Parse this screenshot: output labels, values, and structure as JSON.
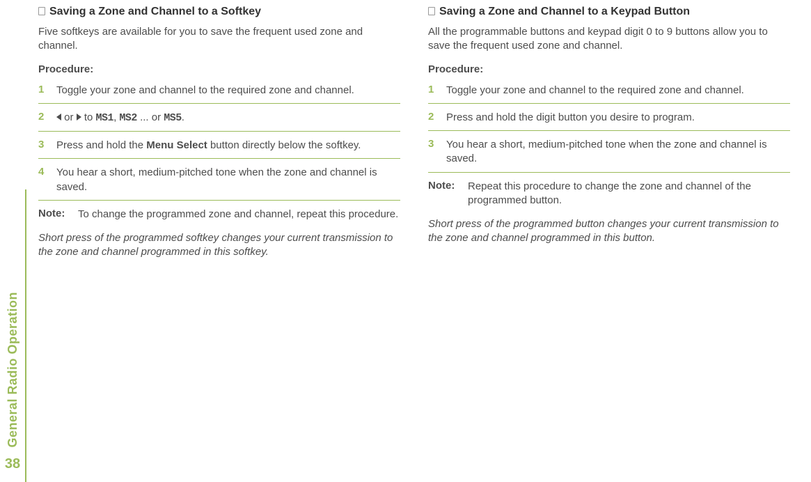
{
  "side": {
    "section_title": "General Radio Operation",
    "page_number": "38"
  },
  "left": {
    "heading": "Saving a Zone and Channel to a Softkey",
    "intro": "Five softkeys are available for you to save the frequent used zone and channel.",
    "procedure_label": "Procedure:",
    "steps": {
      "n1": "1",
      "s1": "Toggle your zone and channel to the required zone and channel.",
      "n2": "2",
      "s2_or": " or ",
      "s2_to": " to ",
      "s2_ms1": "MS1",
      "s2_comma": ", ",
      "s2_ms2": "MS2",
      "s2_dots": " ... or ",
      "s2_ms5": "MS5",
      "s2_period": ".",
      "n3": "3",
      "s3_a": "Press and hold the ",
      "s3_b": "Menu Select",
      "s3_c": " button directly below the softkey.",
      "n4": "4",
      "s4": "You hear a short, medium-pitched tone when the zone and channel is saved."
    },
    "note_label": "Note:",
    "note_text": "To change the programmed zone and channel, repeat this procedure.",
    "italic": "Short press of the programmed softkey changes your current transmission to the zone and channel programmed in this softkey."
  },
  "right": {
    "heading": "Saving a Zone and Channel to a Keypad Button",
    "intro": "All the programmable buttons and keypad digit 0 to 9 buttons allow you to save the frequent used zone and channel.",
    "procedure_label": "Procedure:",
    "steps": {
      "n1": "1",
      "s1": "Toggle your zone and channel to the required zone and channel.",
      "n2": "2",
      "s2": "Press and hold the digit button you desire to program.",
      "n3": "3",
      "s3": "You hear a short, medium-pitched tone when the zone and channel is saved."
    },
    "note_label": "Note:",
    "note_text": "Repeat this procedure to change the zone and channel of the programmed button.",
    "italic": "Short press of the programmed button changes your current transmission to the zone and channel programmed in this button."
  }
}
